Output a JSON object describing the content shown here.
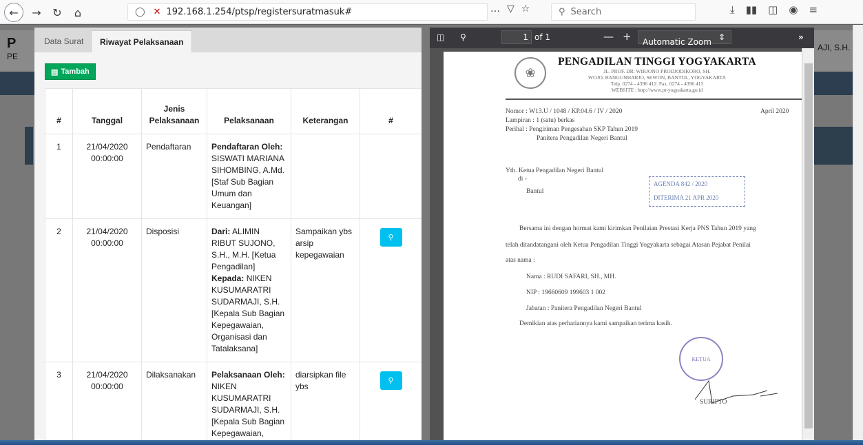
{
  "browser": {
    "url": "192.168.1.254/ptsp/registersuratmasuk#",
    "search_placeholder": "Search",
    "more_icon": "…"
  },
  "bg": {
    "title_letter": "P",
    "title_sub": "PE",
    "user_name": "AJI, S.H."
  },
  "tabs": [
    {
      "label": "Data Surat"
    },
    {
      "label": "Riwayat Pelaksanaan"
    }
  ],
  "add_button_label": "Tambah",
  "table": {
    "headers": [
      "#",
      "Tanggal",
      "Jenis Pelaksanaan",
      "Pelaksanaan",
      "Keterangan",
      "#"
    ],
    "rows": [
      {
        "no": "1",
        "tanggal": "21/04/2020 00:00:00",
        "jenis": "Pendaftaran",
        "label1": "Pendaftaran Oleh:",
        "text1": "SISWATI MARIANA SIHOMBING, A.Md. [Staf Sub Bagian Umum dan Keuangan]",
        "keterangan": ""
      },
      {
        "no": "2",
        "tanggal": "21/04/2020 00:00:00",
        "jenis": "Disposisi",
        "label1": "Dari:",
        "text1": "ALIMIN RIBUT SUJONO, S.H., M.H. [Ketua Pengadilan]",
        "label2": "Kepada:",
        "text2": "NIKEN KUSUMARATRI SUDARMAJI, S.H. [Kepala Sub Bagian Kepegawaian, Organisasi dan Tatalaksana]",
        "keterangan": "Sampaikan ybs arsip kepegawaian"
      },
      {
        "no": "3",
        "tanggal": "21/04/2020 00:00:00",
        "jenis": "Dilaksanakan",
        "label1": "Pelaksanaan Oleh:",
        "text1": "NIKEN KUSUMARATRI SUDARMAJI, S.H. [Kepala Sub Bagian Kepegawaian, Organisasi dan",
        "keterangan": "diarsipkan file ybs"
      }
    ]
  },
  "pdf": {
    "page_current": "1",
    "page_of": "of 1",
    "zoom": "Automatic Zoom",
    "court_name": "PENGADILAN TINGGI YOGYAKARTA",
    "addr1": "JL. PROF. DR. WIRJONO PRODJODIKORO, SH.",
    "addr2": "WOJO, BANGUNHARJO, SEWON, BANTUL, YOGYAKARTA",
    "addr3": "Telp. 0274 - 4396 412. Fax. 0274 - 4396 413",
    "addr4": "WEBSITE : http://www.pt-yogyakarta.go.id",
    "nomor": "Nomor   : W13.U / 1048 / KP.04.6 / IV / 2020",
    "date": "April 2020",
    "lampiran": "Lampiran : 1 (satu) berkas",
    "perihal1": "Perihal   : Pengiriman  Pengesahan  SKP  Tahun  2019",
    "perihal2": "Panitera Pengadilan Negeri Bantul",
    "yth": "Yth. Ketua Pengadilan Negeri Bantul",
    "di": "di -",
    "bantul": "Bantul",
    "agenda": "AGENDA 842 / 2020",
    "diterima": "DITERIMA 21 APR 2020",
    "body1": "Bersama ini dengan hormat kami kirimkan Penilaian Prestasi Kerja PNS Tahun 2019 yang",
    "body2": "telah ditandatangani oleh Ketua Pengadilan Tinggi Yogyakarta sebagai Atasan Pejabat Penilai",
    "body3": "atas nama :",
    "nama": "Nama    : RUDI SAFARI, SH., MH.",
    "nip": "NIP     : 19660609 199603 1 002",
    "jabatan": "Jabatan  : Panitera Pengadilan Negeri Bantul",
    "closing": "Demikian atas perhatiannya kami sampaikan terima kasih.",
    "seal_text": "KETUA",
    "signer": "SURIPTO"
  }
}
